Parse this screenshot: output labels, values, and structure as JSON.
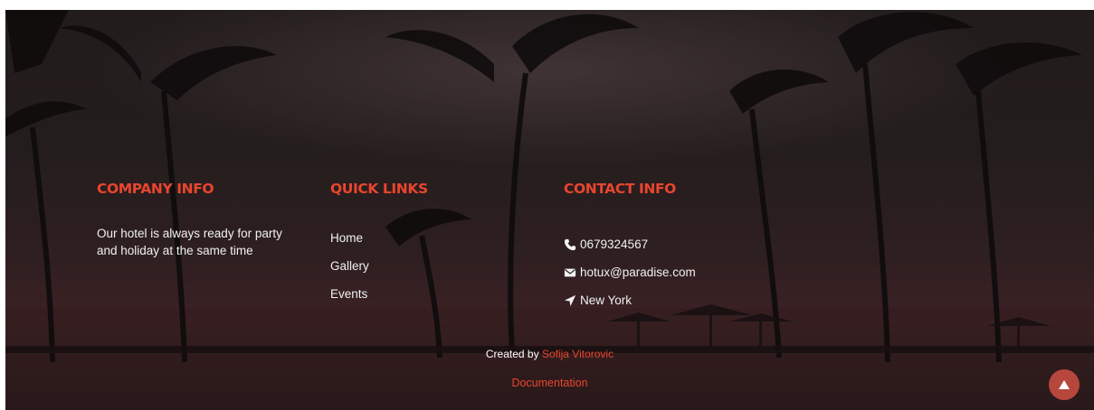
{
  "colors": {
    "accent": "#e8452f",
    "text": "#f1f1f1",
    "to_top_button": "#b7473d"
  },
  "footer": {
    "company": {
      "heading": "COMPANY INFO",
      "text": "Our hotel is always ready for party and holiday at the same time"
    },
    "quick_links": {
      "heading": "QUICK LINKS",
      "items": [
        "Home",
        "Gallery",
        "Events"
      ]
    },
    "contact": {
      "heading": "CONTACT INFO",
      "phone": "0679324567",
      "email": "hotux@paradise.com",
      "location": "New York",
      "icons": [
        "phone-icon",
        "envelope-icon",
        "location-arrow-icon"
      ]
    },
    "credit": {
      "prefix": "Created by",
      "author": "Sofija Vitorovic"
    },
    "documentation": "Documentation",
    "back_to_top_icon": "triangle-up-icon"
  }
}
